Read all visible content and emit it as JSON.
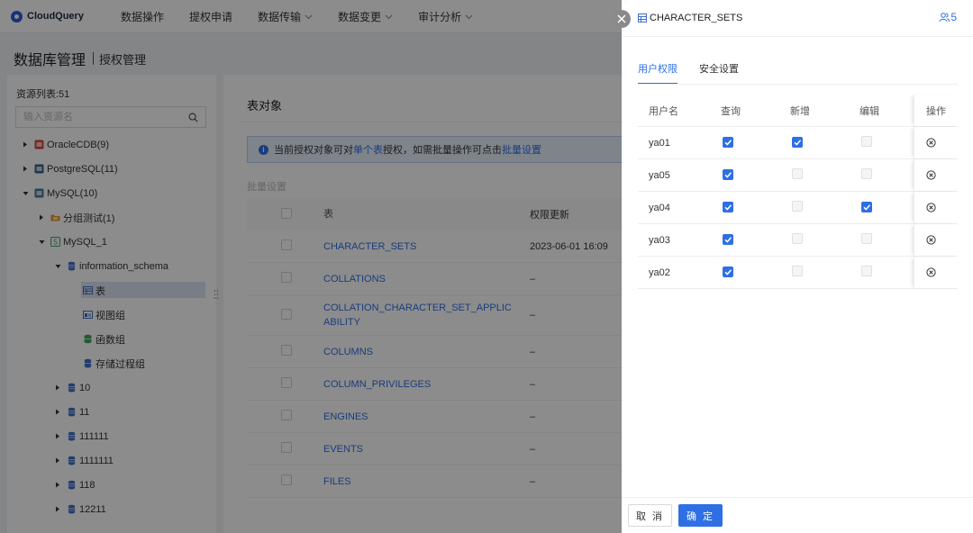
{
  "app": {
    "name": "CloudQuery"
  },
  "nav": {
    "items": [
      {
        "label": "数据操作",
        "dropdown": false
      },
      {
        "label": "提权申请",
        "dropdown": false
      },
      {
        "label": "数据传输",
        "dropdown": true
      },
      {
        "label": "数据变更",
        "dropdown": true
      },
      {
        "label": "审计分析",
        "dropdown": true
      }
    ]
  },
  "page": {
    "title": "数据库管理",
    "subtitle": "授权管理"
  },
  "sidebar": {
    "count_label": "资源列表:51",
    "search_placeholder": "输入资源名",
    "tree": [
      {
        "label": "OracleCDB(9)",
        "depth": 0,
        "expand": "collapsed",
        "icon": "oracle-icon",
        "color": "#d9453a"
      },
      {
        "label": "PostgreSQL(11)",
        "depth": 0,
        "expand": "collapsed",
        "icon": "postgresql-icon",
        "color": "#336791"
      },
      {
        "label": "MySQL(10)",
        "depth": 0,
        "expand": "expanded",
        "icon": "mysql-icon",
        "color": "#4479a1"
      },
      {
        "label": "分组测试(1)",
        "depth": 1,
        "expand": "collapsed",
        "icon": "group-icon",
        "color": "#e89b2d"
      },
      {
        "label": "MySQL_1",
        "depth": 1,
        "expand": "expanded",
        "icon": "connection-icon",
        "color": "#3aa65c"
      },
      {
        "label": "information_schema",
        "depth": 2,
        "expand": "expanded",
        "icon": "database-icon",
        "color": "#3f6fc9"
      },
      {
        "label": "表",
        "depth": 3,
        "expand": "none",
        "icon": "table-icon",
        "color": "#3f6fc9",
        "selected": true
      },
      {
        "label": "视图组",
        "depth": 3,
        "expand": "none",
        "icon": "view-icon",
        "color": "#3f6fc9"
      },
      {
        "label": "函数组",
        "depth": 3,
        "expand": "none",
        "icon": "function-icon",
        "color": "#3aa65c"
      },
      {
        "label": "存储过程组",
        "depth": 3,
        "expand": "none",
        "icon": "procedure-icon",
        "color": "#3f6fc9"
      },
      {
        "label": "10",
        "depth": 2,
        "expand": "collapsed",
        "icon": "database-icon",
        "color": "#3f6fc9"
      },
      {
        "label": "11",
        "depth": 2,
        "expand": "collapsed",
        "icon": "database-icon",
        "color": "#3f6fc9"
      },
      {
        "label": "111111",
        "depth": 2,
        "expand": "collapsed",
        "icon": "database-icon",
        "color": "#3f6fc9"
      },
      {
        "label": "1111111",
        "depth": 2,
        "expand": "collapsed",
        "icon": "database-icon",
        "color": "#3f6fc9"
      },
      {
        "label": "118",
        "depth": 2,
        "expand": "collapsed",
        "icon": "database-icon",
        "color": "#3f6fc9"
      },
      {
        "label": "12211",
        "depth": 2,
        "expand": "collapsed",
        "icon": "database-icon",
        "color": "#3f6fc9"
      }
    ]
  },
  "main": {
    "title": "表对象",
    "info": {
      "prefix": "当前授权对象可对",
      "link1": "单个表",
      "middle": "授权，如需批量操作可点击",
      "link2": "批量设置"
    },
    "batch_label": "批量设置",
    "columns": {
      "table": "表",
      "updated": "权限更新"
    },
    "rows": [
      {
        "name": "CHARACTER_SETS",
        "updated": "2023-06-01 16:09"
      },
      {
        "name": "COLLATIONS",
        "updated": "–"
      },
      {
        "name": "COLLATION_CHARACTER_SET_APPLICABILITY",
        "updated": "–"
      },
      {
        "name": "COLUMNS",
        "updated": "–"
      },
      {
        "name": "COLUMN_PRIVILEGES",
        "updated": "–"
      },
      {
        "name": "ENGINES",
        "updated": "–"
      },
      {
        "name": "EVENTS",
        "updated": "–"
      },
      {
        "name": "FILES",
        "updated": "–"
      }
    ]
  },
  "drawer": {
    "title": "CHARACTER_SETS",
    "user_count": "5",
    "tabs": [
      {
        "label": "用户权限",
        "active": true
      },
      {
        "label": "安全设置",
        "active": false
      }
    ],
    "columns": {
      "user": "用户名",
      "query": "查询",
      "add": "新增",
      "edit": "编辑",
      "op": "操作"
    },
    "rows": [
      {
        "user": "ya01",
        "query": true,
        "add": true,
        "edit": false
      },
      {
        "user": "ya05",
        "query": true,
        "add": false,
        "edit": false
      },
      {
        "user": "ya04",
        "query": true,
        "add": false,
        "edit": true
      },
      {
        "user": "ya03",
        "query": true,
        "add": false,
        "edit": false
      },
      {
        "user": "ya02",
        "query": true,
        "add": false,
        "edit": false
      }
    ],
    "cancel_label": "取 消",
    "ok_label": "确 定"
  },
  "colors": {
    "accent": "#2f6fe4",
    "mask": "rgba(0,0,0,0.45)"
  }
}
